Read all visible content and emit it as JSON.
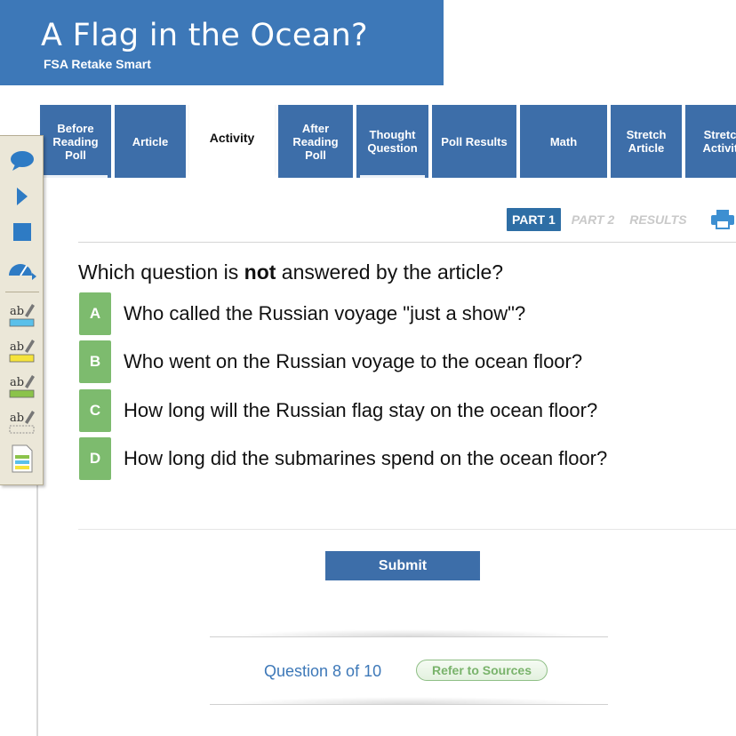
{
  "header": {
    "title": "A Flag in the Ocean?",
    "subtitle": "FSA Retake Smart"
  },
  "tabs": [
    {
      "label": "Before Reading Poll"
    },
    {
      "label": "Article"
    },
    {
      "label": "Activity"
    },
    {
      "label": "After Reading Poll"
    },
    {
      "label": "Thought Question"
    },
    {
      "label": "Poll Results"
    },
    {
      "label": "Math"
    },
    {
      "label": "Stretch Article"
    },
    {
      "label": "Stretch Activity"
    }
  ],
  "toolbar": {
    "tools": [
      "speech-bubble-icon",
      "play-icon",
      "stop-icon",
      "speed-gauge-icon",
      "highlight-blue-icon",
      "highlight-yellow-icon",
      "highlight-green-icon",
      "highlight-clear-icon",
      "notes-icon"
    ]
  },
  "parts": {
    "part1": "PART 1",
    "part2": "PART 2",
    "results": "RESULTS"
  },
  "question": {
    "prefix": "Which question is ",
    "emphasis": "not",
    "suffix": " answered by the article?"
  },
  "options": [
    {
      "letter": "A",
      "text": "Who called the Russian voyage \"just a show\"?"
    },
    {
      "letter": "B",
      "text": "Who went on the Russian voyage to the ocean floor?"
    },
    {
      "letter": "C",
      "text": "How long will the Russian flag stay on the ocean floor?"
    },
    {
      "letter": "D",
      "text": "How long did the submarines spend on the ocean floor?"
    }
  ],
  "submit_label": "Submit",
  "footer": {
    "counter": "Question 8 of 10",
    "refer_label": "Refer to Sources"
  },
  "colors": {
    "header_blue": "#3d78b8",
    "tab_blue": "#3d6ea9",
    "option_green": "#7dbb6e",
    "toolbar_bg": "#ebe7d8"
  }
}
